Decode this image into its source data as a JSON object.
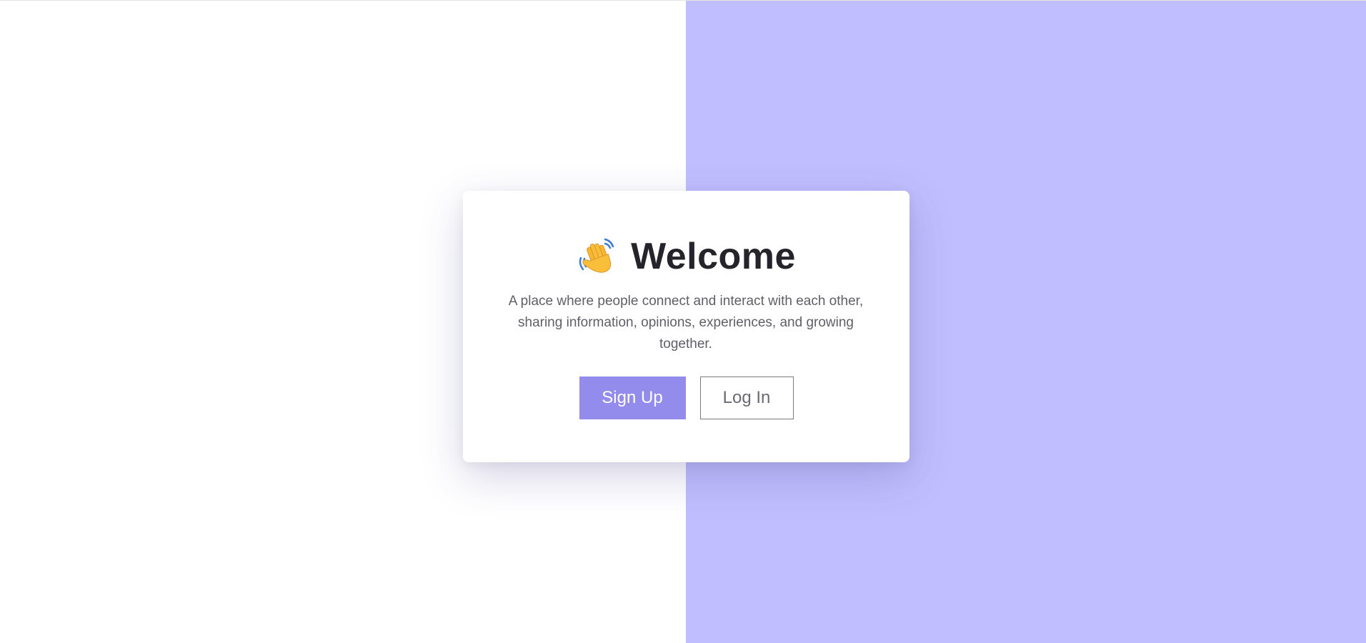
{
  "welcome": {
    "icon": "waving-hand-icon",
    "title": "Welcome",
    "description": "A place where people connect and interact with each other, sharing information, opinions, experiences, and growing together."
  },
  "actions": {
    "signup_label": "Sign Up",
    "login_label": "Log In"
  },
  "colors": {
    "right_panel": "#c0befe",
    "signup_button": "#948cec",
    "card_background": "#ffffff",
    "title_text": "#24242a"
  }
}
